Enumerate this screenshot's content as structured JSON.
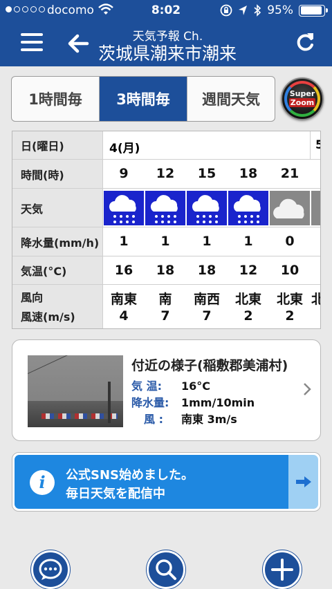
{
  "status": {
    "carrier": "docomo",
    "time": "8:02",
    "battery": "95%"
  },
  "header": {
    "subtitle": "天気予報 Ch.",
    "title": "茨城県潮来市潮来"
  },
  "tabs": [
    {
      "label": "1時間毎",
      "active": false
    },
    {
      "label": "3時間毎",
      "active": true
    },
    {
      "label": "週間天気",
      "active": false
    }
  ],
  "superzoom": {
    "line1": "Super",
    "line2": "Zoom"
  },
  "table": {
    "labels": {
      "day": "日(曜日)",
      "time": "時間(時)",
      "weather": "天気",
      "precip": "降水量(mm/h)",
      "temp": "気温(°C)",
      "wind_dir": "風向",
      "wind_speed": "風速(m/s)"
    },
    "day": "4(月)",
    "next_day": "5",
    "columns": [
      {
        "time": "9",
        "weather": "rain",
        "precip": "1",
        "temp": "16",
        "dir": "南東",
        "speed": "4"
      },
      {
        "time": "12",
        "weather": "rain",
        "precip": "1",
        "temp": "18",
        "dir": "南",
        "speed": "7"
      },
      {
        "time": "15",
        "weather": "rain",
        "precip": "1",
        "temp": "18",
        "dir": "南西",
        "speed": "7"
      },
      {
        "time": "18",
        "weather": "rain",
        "precip": "1",
        "temp": "12",
        "dir": "北東",
        "speed": "2"
      },
      {
        "time": "21",
        "weather": "cloudy",
        "precip": "0",
        "temp": "10",
        "dir": "北東",
        "speed": "2"
      }
    ],
    "partial_dir": "北"
  },
  "nearby": {
    "title": "付近の様子(稲敷郡美浦村)",
    "temp_label": "気  温:",
    "temp_value": "16°C",
    "precip_label": "降水量:",
    "precip_value": "1mm/10min",
    "wind_label": "風  :",
    "wind_value": "南東 3m/s"
  },
  "banner": {
    "line1": "公式SNS始めました。",
    "line2": "毎日天気を配信中"
  },
  "icons": {
    "menu": "menu-icon",
    "back": "back-arrow-icon",
    "refresh": "refresh-icon",
    "rain": "rain-cloud-icon",
    "cloud": "cloud-icon",
    "chat": "chat-icon",
    "search": "search-icon",
    "add": "plus-icon"
  },
  "colors": {
    "brand": "#1d4f9a",
    "rain_bg": "#1a24cc",
    "banner": "#1e87e0"
  }
}
